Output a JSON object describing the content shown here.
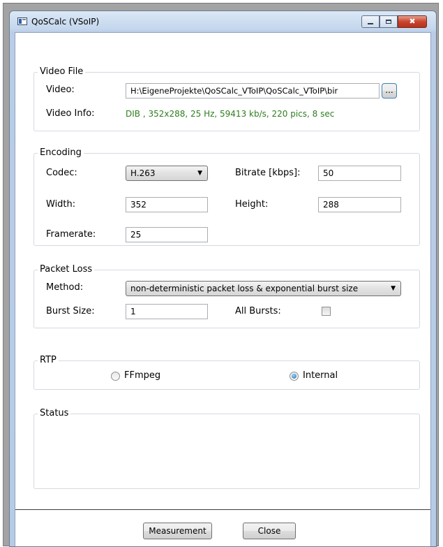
{
  "window": {
    "title": "QoSCalc (VSoIP)",
    "close_glyph": "✖"
  },
  "video_file": {
    "title": "Video File",
    "video_label": "Video:",
    "video_path": "H:\\EigeneProjekte\\QoSCalc_VToIP\\QoSCalc_VToIP\\bir",
    "browse_label": "...",
    "info_label": "Video Info:",
    "info_text": "DIB , 352x288, 25 Hz, 59413 kb/s, 220 pics, 8 sec",
    "info_color": "#2e7d1e"
  },
  "encoding": {
    "title": "Encoding",
    "codec_label": "Codec:",
    "codec_value": "H.263",
    "bitrate_label": "Bitrate [kbps]:",
    "bitrate_value": "50",
    "width_label": "Width:",
    "width_value": "352",
    "height_label": "Height:",
    "height_value": "288",
    "framerate_label": "Framerate:",
    "framerate_value": "25"
  },
  "packet_loss": {
    "title": "Packet Loss",
    "method_label": "Method:",
    "method_value": "non-deterministic packet loss & exponential burst size",
    "burst_size_label": "Burst Size:",
    "burst_size_value": "1",
    "all_bursts_label": "All Bursts:",
    "all_bursts_checked": false
  },
  "rtp": {
    "title": "RTP",
    "options": [
      {
        "label": "FFmpeg",
        "selected": false
      },
      {
        "label": "Internal",
        "selected": true
      }
    ]
  },
  "status": {
    "title": "Status",
    "text": ""
  },
  "buttons": {
    "measurement": "Measurement",
    "close": "Close"
  },
  "icons": {
    "app": "app-window-icon",
    "minimize": "minimize-icon",
    "maximize": "maximize-icon",
    "close": "close-icon",
    "dropdown": "chevron-down-icon"
  }
}
